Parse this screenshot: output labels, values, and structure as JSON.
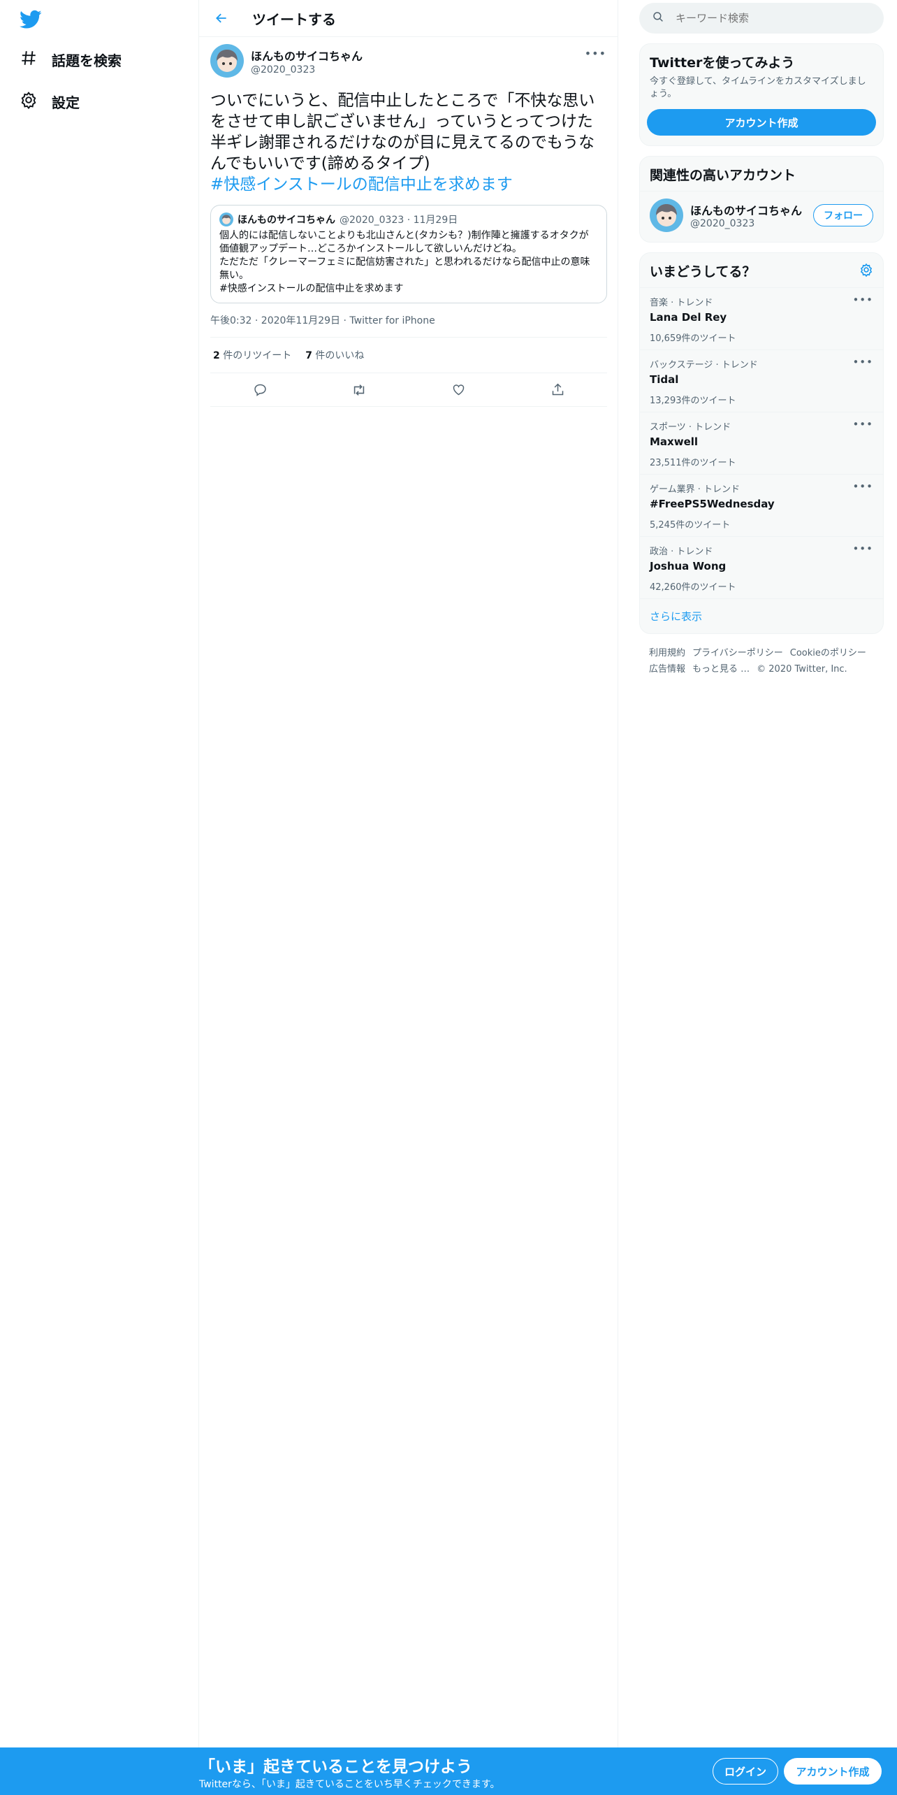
{
  "colors": {
    "accent": "#1d9bf0",
    "text": "#0f1419",
    "secondary": "#536471",
    "border": "#eff3f4"
  },
  "nav": {
    "logo_icon": "twitter-bird-icon",
    "items": [
      {
        "label": "話題を検索",
        "icon": "hashtag-icon"
      },
      {
        "label": "設定",
        "icon": "gear-icon"
      }
    ]
  },
  "header": {
    "title": "ツイートする",
    "back_icon": "back-arrow-icon"
  },
  "tweet": {
    "author_name": "ほんものサイコちゃん",
    "author_handle": "@2020_0323",
    "text": "ついでにいうと、配信中止したところで「不快な思いをさせて申し訳ございません」っていうとってつけた半ギレ謝罪されるだけなのが目に見えてるのでもうなんでもいいです(諦めるタイプ)",
    "hashtag": "#快感インストールの配信中止を求めます",
    "quote": {
      "author_name": "ほんものサイコちゃん",
      "handle_date": "@2020_0323 · 11月29日",
      "text": "個人的には配信しないことよりも北山さんと(タカシも？)制作陣と擁護するオタクが価値観アップデート…どころかインストールして欲しいんだけどね。\nただただ「クレーマーフェミに配信妨害された」と思われるだけなら配信中止の意味無い。\n#快感インストールの配信中止を求めます"
    },
    "time": "午後0:32 · 2020年11月29日 · Twitter for iPhone",
    "retweets_count": "2",
    "retweets_label": " 件のリツイート",
    "likes_count": "7",
    "likes_label": " 件のいいね"
  },
  "sidebar": {
    "search_placeholder": "キーワード検索",
    "signup_card": {
      "title": "Twitterを使ってみよう",
      "desc": "今すぐ登録して、タイムラインをカスタマイズしましょう。",
      "button": "アカウント作成"
    },
    "related": {
      "title": "関連性の高いアカウント",
      "name": "ほんものサイコちゃん",
      "handle": "@2020_0323",
      "follow": "フォロー"
    },
    "trends": {
      "title": "いまどうしてる？",
      "items": [
        {
          "context": "音楽 · トレンド",
          "name": "Lana Del Rey",
          "count": "10,659件のツイート"
        },
        {
          "context": "バックステージ · トレンド",
          "name": "Tidal",
          "count": "13,293件のツイート"
        },
        {
          "context": "スポーツ · トレンド",
          "name": "Maxwell",
          "count": "23,511件のツイート"
        },
        {
          "context": "ゲーム業界 · トレンド",
          "name": "#FreePS5Wednesday",
          "count": "5,245件のツイート"
        },
        {
          "context": "政治 · トレンド",
          "name": "Joshua Wong",
          "count": "42,260件のツイート"
        }
      ],
      "show_more": "さらに表示"
    },
    "footer": {
      "terms": "利用規約",
      "privacy": "プライバシーポリシー",
      "cookie": "Cookieのポリシー",
      "ads": "広告情報",
      "more": "もっと見る …",
      "copyright": "© 2020 Twitter, Inc."
    }
  },
  "banner": {
    "title": "「いま」起きていることを見つけよう",
    "subtitle": "Twitterなら、「いま」起きていることをいち早くチェックできます。",
    "login": "ログイン",
    "signup": "アカウント作成"
  }
}
